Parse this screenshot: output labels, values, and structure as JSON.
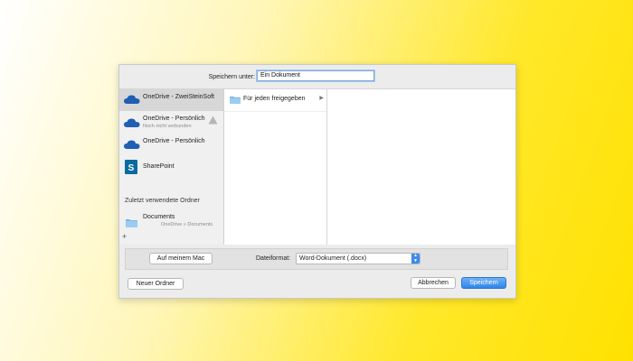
{
  "dialog": {
    "save_as_label": "Speichern unter:",
    "save_as_value": "Ein Dokument"
  },
  "sidebar": {
    "items": [
      {
        "title": "OneDrive - ZweiSteinSoft",
        "subtitle": "",
        "icon": "onedrive-cloud-icon"
      },
      {
        "title": "OneDrive - Persönlich",
        "subtitle": "Noch nicht verbunden",
        "icon": "onedrive-cloud-icon"
      },
      {
        "title": "OneDrive - Persönlich",
        "subtitle": "",
        "icon": "onedrive-cloud-icon"
      },
      {
        "title": "SharePoint",
        "subtitle": "",
        "icon": "sharepoint-icon"
      }
    ],
    "recent_heading": "Zuletzt verwendete Ordner",
    "recent_items": [
      {
        "title": "Documents",
        "subtitle": "OneDrive » Documents",
        "icon": "folder-icon"
      }
    ],
    "add_label": "+"
  },
  "columns": {
    "col1": [
      {
        "label": "Für jeden freigegeben",
        "icon": "folder-icon",
        "has_children": true
      }
    ]
  },
  "format_bar": {
    "on_my_mac_label": "Auf meinem Mac",
    "format_label": "Dateiformat:",
    "format_value": "Word-Dokument (.docx)"
  },
  "footer": {
    "new_folder_label": "Neuer Ordner",
    "cancel_label": "Abbrechen",
    "save_label": "Speichern"
  },
  "colors": {
    "onedrive_blue": "#1f5fb4",
    "sharepoint_blue": "#0b6a9e",
    "accent_blue": "#2f86ea",
    "warning_gray": "#b5b5b5"
  }
}
